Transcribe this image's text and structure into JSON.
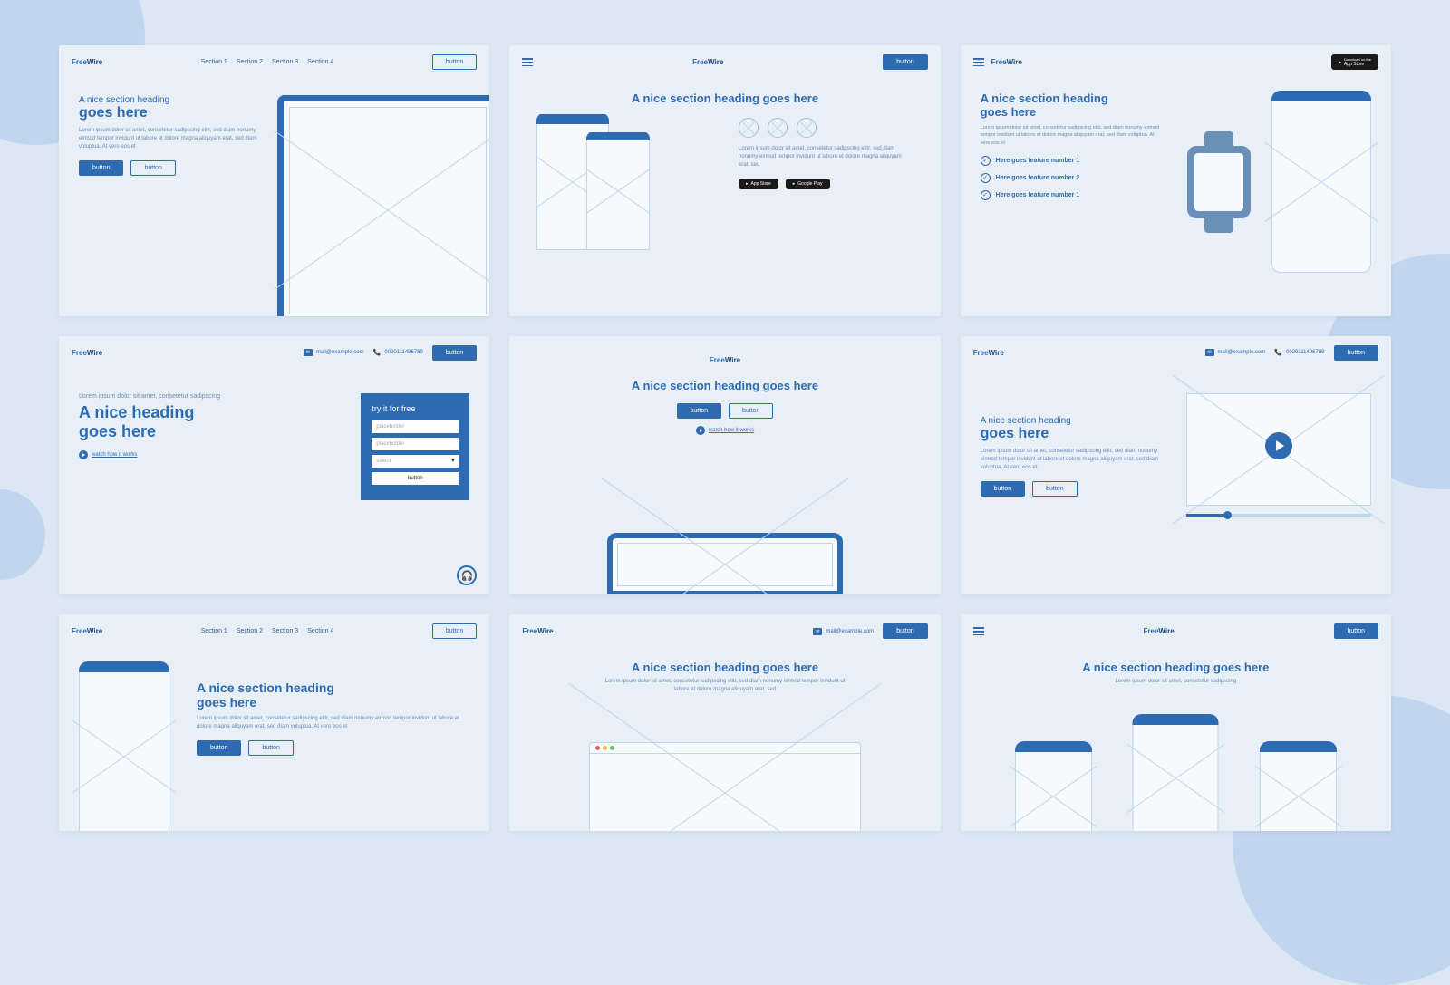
{
  "brand": {
    "pre": "Free",
    "post": "Wire"
  },
  "nav": {
    "s1": "Section 1",
    "s2": "Section 2",
    "s3": "Section 3",
    "s4": "Section 4"
  },
  "btn": {
    "primary": "button",
    "secondary": "button"
  },
  "lorem_short": "Lorem ipsum dolor sit amet, consetetur sadipscing",
  "lorem": "Lorem ipsum dolor sit amet, consetetur sadipscing elitr, sed diam nonumy eirmod tempor invidunt ut labore et dolore magna aliquyam erat, sed diam voluptua. At vero eos et",
  "lorem2": "Lorem ipsum dolor sit amet, consetetur sadipscing elitr, sed diam nonumy eirmod tempor invidunt ut labore et dolore magna aliquyam erat, sed",
  "c1": {
    "sub": "A nice section heading",
    "main": "goes here"
  },
  "c2": {
    "heading": "A nice section heading goes here"
  },
  "c3": {
    "sub": "A nice section heading",
    "main": "goes here",
    "f1": "Here goes feature number 1",
    "f2": "Here goes feature number 2",
    "f3": "Here goes feature number 1"
  },
  "c4": {
    "pre": "Lorem ipsum dolor sit amet, consetetur sadipscing",
    "sub": "A nice heading",
    "main": "goes here",
    "link": "watch how it works",
    "form_title": "try it for free",
    "ph": "placeholder",
    "sel": "select",
    "fbtn": "button"
  },
  "c5": {
    "heading": "A nice section heading goes here",
    "link": "watch how it works"
  },
  "c6": {
    "sub": "A nice section heading",
    "main": "goes here"
  },
  "c7": {
    "sub": "A nice section heading",
    "main": "goes here"
  },
  "c8": {
    "heading": "A nice section heading goes here"
  },
  "c9": {
    "heading": "A nice section heading goes here"
  },
  "contact": {
    "email": "mail@example.com",
    "phone": "0020111496789"
  },
  "store": {
    "appstore": "App Store",
    "gplay": "Google Play",
    "dl": "Download on the"
  }
}
